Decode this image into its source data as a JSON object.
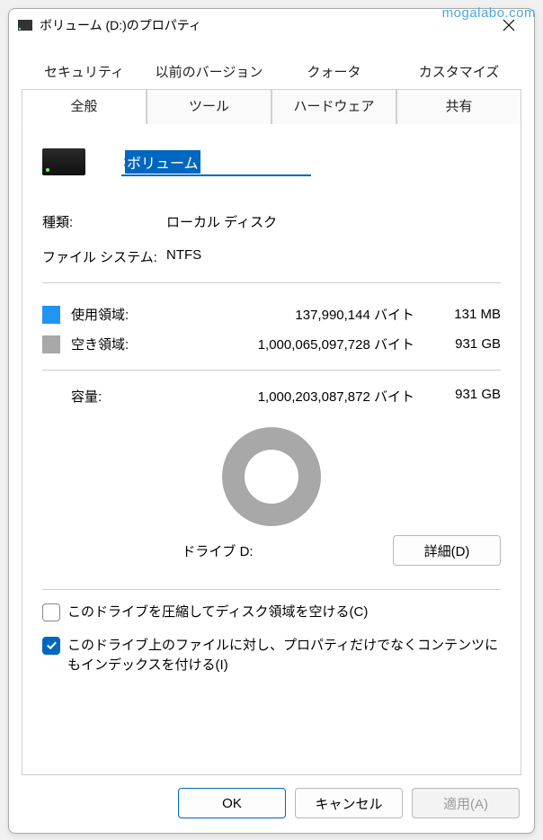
{
  "watermark": "mogalabo.com",
  "window": {
    "title": "ボリューム (D:)のプロパティ"
  },
  "tabs": {
    "row1": [
      "セキュリティ",
      "以前のバージョン",
      "クォータ",
      "カスタマイズ"
    ],
    "row2": [
      "全般",
      "ツール",
      "ハードウェア",
      "共有"
    ]
  },
  "volume_name": "ボリューム",
  "info": {
    "type_label": "種類:",
    "type_value": "ローカル ディスク",
    "fs_label": "ファイル システム:",
    "fs_value": "NTFS"
  },
  "storage": {
    "used_label": "使用領域:",
    "used_bytes": "137,990,144 バイト",
    "used_human": "131 MB",
    "free_label": "空き領域:",
    "free_bytes": "1,000,065,097,728 バイト",
    "free_human": "931 GB",
    "capacity_label": "容量:",
    "capacity_bytes": "1,000,203,087,872 バイト",
    "capacity_human": "931 GB"
  },
  "drive_label": "ドライブ D:",
  "detail_btn": "詳細(D)",
  "checkboxes": {
    "compress": "このドライブを圧縮してディスク領域を空ける(C)",
    "index": "このドライブ上のファイルに対し、プロパティだけでなくコンテンツにもインデックスを付ける(I)"
  },
  "footer": {
    "ok": "OK",
    "cancel": "キャンセル",
    "apply": "適用(A)"
  },
  "chart_data": {
    "type": "pie",
    "title": "ドライブ D:",
    "series": [
      {
        "name": "使用領域",
        "value": 137990144,
        "human": "131 MB",
        "color": "#2095f2"
      },
      {
        "name": "空き領域",
        "value": 1000065097728,
        "human": "931 GB",
        "color": "#a8a8a8"
      }
    ],
    "total": 1000203087872
  }
}
